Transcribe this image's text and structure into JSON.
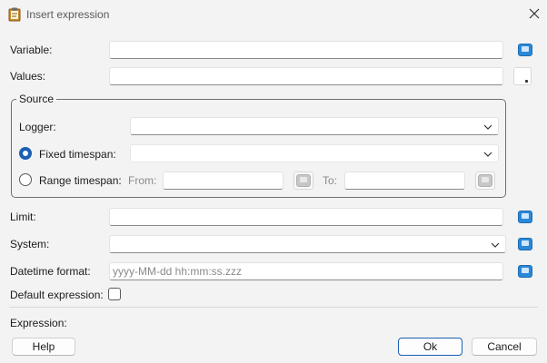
{
  "window": {
    "title": "Insert expression"
  },
  "form": {
    "variable": {
      "label": "Variable:",
      "value": ""
    },
    "values": {
      "label": "Values:",
      "value": ""
    },
    "source": {
      "legend": "Source",
      "logger": {
        "label": "Logger:",
        "value": ""
      },
      "fixed_timespan": {
        "label": "Fixed timespan:",
        "selected": true,
        "value": ""
      },
      "range_timespan": {
        "label": "Range timespan:",
        "selected": false,
        "from_label": "From:",
        "to_label": "To:",
        "from_value": "",
        "to_value": ""
      }
    },
    "limit": {
      "label": "Limit:",
      "value": ""
    },
    "system": {
      "label": "System:",
      "value": ""
    },
    "datetime_format": {
      "label": "Datetime format:",
      "placeholder": "yyyy-MM-dd hh:mm:ss.zzz"
    },
    "default_expression": {
      "label": "Default expression:",
      "checked": false
    },
    "expression": {
      "label": "Expression:"
    }
  },
  "buttons": {
    "help": "Help",
    "ok": "Ok",
    "cancel": "Cancel"
  },
  "icons": {
    "app": "clipboard-icon",
    "close": "close-icon",
    "info": "info-button-icon",
    "chevron": "chevron-down-icon"
  },
  "colors": {
    "accent": "#1a5fb4",
    "info_button": "#2b88d8",
    "background": "#f3f3f3"
  }
}
